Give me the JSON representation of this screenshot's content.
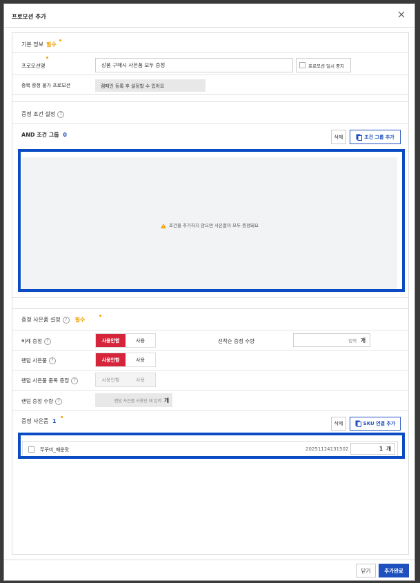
{
  "dialog": {
    "title": "프로모션 추가",
    "close_icon": "close-icon"
  },
  "basic": {
    "title": "기본 정보",
    "required": "필수",
    "promo_name_label": "프로모션명",
    "promo_name_value": "상품 구매시 사은품 모두 증정",
    "pause_label": "프로모션 일시 중지",
    "dup_label": "중복 증정 불가 프로모션",
    "dup_value": "캠페인 등록 후 설정할 수 있어요"
  },
  "condition": {
    "title": "증정 조건 설정",
    "group_label": "AND 조건 그룹",
    "group_count": "0",
    "delete_label": "삭제",
    "add_group_label": "조건 그룹 추가",
    "empty_message": "조건을 추가하지 않으면 사은품이 모두 증정돼요",
    "warning_icon": "warning-icon"
  },
  "gift": {
    "title": "증정 사은품 설정",
    "required": "필수",
    "ratio_label": "비례 증정",
    "ratio_off": "사용안함",
    "ratio_on": "사용",
    "first_come_label": "선착순 증정 수량",
    "first_come_placeholder": "입력",
    "unit": "개",
    "random_label": "랜덤 사은품",
    "random_off": "사용안함",
    "random_on": "사용",
    "random_dup_label": "랜덤 사은품 중복 증정",
    "random_dup_off": "사용안함",
    "random_dup_on": "사용",
    "random_qty_label": "랜덤 증정 수량",
    "random_qty_value": "랜덤 사은품 사용인 때 입력",
    "list_label": "증정 사은품",
    "list_count": "1",
    "list_delete": "삭제",
    "sku_add": "SKU 연결 추가",
    "items": [
      {
        "name": "쭈꾸미_매운맛",
        "sku": "20251124131502",
        "qty": "1",
        "unit": "개"
      }
    ]
  },
  "footer": {
    "close_label": "닫기",
    "submit_label": "추가완료"
  },
  "colors": {
    "accent_blue": "#1e4fbf",
    "focus_blue": "#0a4bc4",
    "active_red": "#d6243a",
    "required_orange": "#f0a000"
  }
}
